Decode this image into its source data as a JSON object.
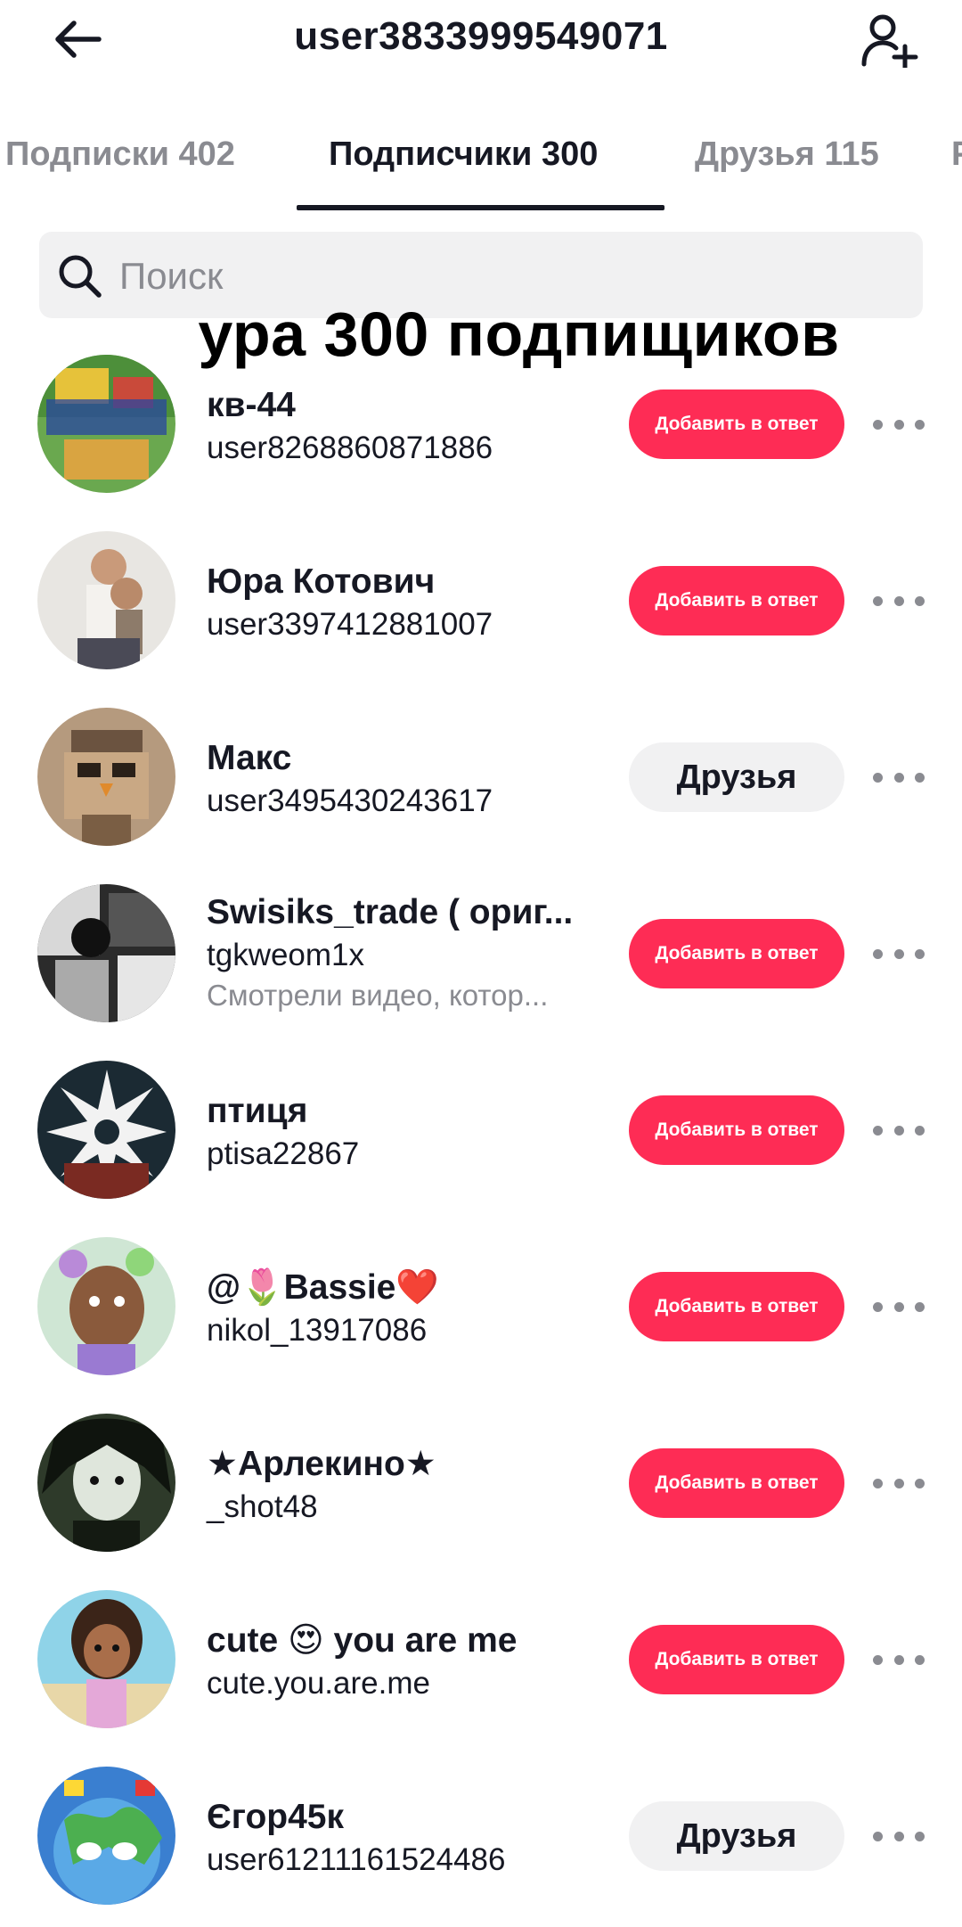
{
  "header": {
    "title": "user3833999549071",
    "back_icon": "arrow-left-icon",
    "add_user_icon": "person-plus-icon"
  },
  "tabs": [
    {
      "label": "Подписки 402",
      "active": false
    },
    {
      "label": "Подписчики 300",
      "active": true
    },
    {
      "label": "Друзья 115",
      "active": false
    },
    {
      "label": "Р",
      "active": false
    }
  ],
  "search": {
    "placeholder": "Поиск",
    "value": ""
  },
  "overlay_caption": "ура 300 подпищиков",
  "colors": {
    "accent": "#fe2c55",
    "text": "#161823",
    "muted": "#8a8b91",
    "chip": "#f1f1f2"
  },
  "users": [
    {
      "name": "кв-44",
      "handle": "user8268860871886",
      "action": "Добавить в ответ",
      "action_type": "follow"
    },
    {
      "name": "Юра Котович",
      "handle": "user3397412881007",
      "action": "Добавить в ответ",
      "action_type": "follow"
    },
    {
      "name": "Макс",
      "handle": "user3495430243617",
      "action": "Друзья",
      "action_type": "friends"
    },
    {
      "name": "Swisiks_trade ( ориг...",
      "handle": "tgkweom1x",
      "sub": "Смотрели видео, котор...",
      "action": "Добавить в ответ",
      "action_type": "follow"
    },
    {
      "name": "птиця",
      "handle": "ptisa22867",
      "action": "Добавить в ответ",
      "action_type": "follow"
    },
    {
      "name": "@🌷Bassie❤️",
      "handle": "nikol_13917086",
      "action": "Добавить в ответ",
      "action_type": "follow"
    },
    {
      "name": "★Арлекино★",
      "handle": "_shot48",
      "action": "Добавить в ответ",
      "action_type": "follow"
    },
    {
      "name": "cute 😍 you are me",
      "handle": "cute.you.are.me",
      "action": "Добавить в ответ",
      "action_type": "follow"
    },
    {
      "name": "Єгор45к",
      "handle": "user61211161524486",
      "action": "Друзья",
      "action_type": "friends"
    }
  ]
}
